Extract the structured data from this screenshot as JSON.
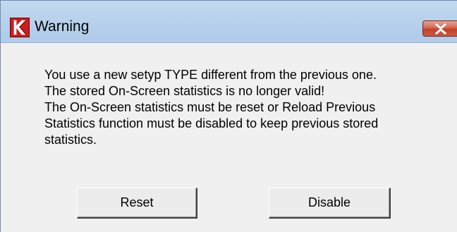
{
  "window": {
    "title": "Warning",
    "app_icon": "app-logo-icon",
    "close_icon": "close-icon"
  },
  "message": {
    "lines": [
      "You use a new setyp TYPE different from the previous one.",
      "The stored On-Screen statistics is no longer valid!",
      "The On-Screen statistics must be reset or Reload Previous",
      "Statistics function must be disabled to keep previous stored",
      "statistics."
    ]
  },
  "buttons": {
    "reset_label": "Reset",
    "disable_label": "Disable"
  },
  "colors": {
    "titlebar": "#b9d2ec",
    "close_button": "#c3402a",
    "app_icon": "#cc1e1e",
    "dialog_bg": "#f0f0f0"
  }
}
